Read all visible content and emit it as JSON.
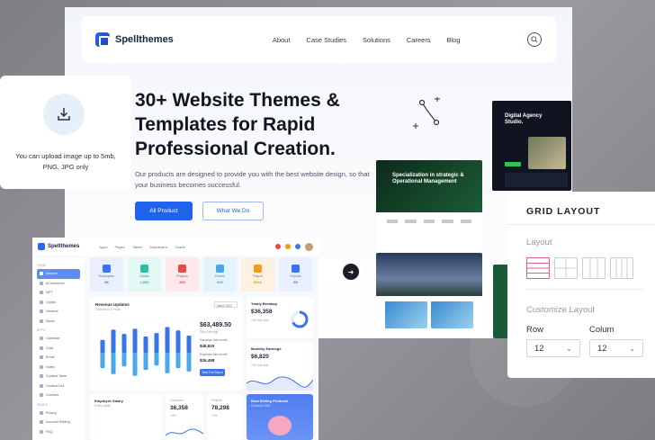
{
  "landing": {
    "brand": "Spellthemes",
    "nav": [
      "About",
      "Case Studies",
      "Solutions",
      "Careers",
      "Blog"
    ],
    "hero_title": "30+ Website Themes & Templates for Rapid Professional Creation.",
    "hero_subtitle": "Our products are designed to provide you with the best website design, so that your business becomes successful.",
    "primary_button": "All Product",
    "secondary_button": "What We Do",
    "previews": {
      "agency_title": "Digital Agency Studio.",
      "strategy_title": "Specialization in strategic & Operational Management"
    }
  },
  "upload": {
    "icon": "upload-icon",
    "text": "You can upload image up to 5mb, PNG, JPG only"
  },
  "dashboard": {
    "brand": "Spellthemes",
    "menu": [
      "Apps",
      "Pages",
      "Tables",
      "Dashboard",
      "Charts"
    ],
    "sidebar": {
      "section_home": "HOME",
      "home_items": [
        "Modern",
        "eCommerce",
        "NFT",
        "Crypto",
        "General",
        "Music"
      ],
      "section_apps": "APPS",
      "app_items": [
        "Calendar",
        "Chat",
        "Email",
        "Notes",
        "Contact Table",
        "Contact List",
        "Courses"
      ],
      "section_pages": "PAGES",
      "page_items": [
        "Pricing",
        "Account Setting",
        "FAQ"
      ]
    },
    "tiles": [
      {
        "label": "Employees",
        "value": "96",
        "color": "#3b73ea",
        "bg": "#e8f0fd"
      },
      {
        "label": "Clients",
        "value": "3,650",
        "color": "#2bbfa3",
        "bg": "#e4f8f4"
      },
      {
        "label": "Projects",
        "value": "356",
        "color": "#e24b4b",
        "bg": "#fde9e9"
      },
      {
        "label": "Events",
        "value": "696",
        "color": "#4aa8e8",
        "bg": "#e4f3fc"
      },
      {
        "label": "Payroll",
        "value": "$96k",
        "color": "#f29b1a",
        "bg": "#fdf2e1"
      },
      {
        "label": "Reports",
        "value": "59",
        "color": "#3b73ea",
        "bg": "#e8f0fd"
      }
    ],
    "revenue": {
      "title": "Revenue Updates",
      "subtitle": "Overview of Profit",
      "period": "March 2023",
      "total": "$63,489.50",
      "total_label": "Total Earnings",
      "earnings_label": "Earnings this month",
      "earnings_value": "$48,820",
      "expense_label": "Expense this month",
      "expense_value": "$26,498",
      "button": "View Full Report"
    },
    "yearly_breakup": {
      "title": "Yearly Breakup",
      "value": "$36,358",
      "note": "+9% last year"
    },
    "monthly_earnings": {
      "title": "Monthly Earnings",
      "value": "$6,820",
      "note": "+9% last year"
    },
    "employee_salary": {
      "title": "Employee Salary",
      "subtitle": "Every month"
    },
    "customers": {
      "title": "Customers",
      "value": "36,358",
      "note": "+9%"
    },
    "projects": {
      "title": "Projects",
      "value": "78,298",
      "note": "+9%"
    },
    "best_selling": {
      "title": "Best Selling Products",
      "subtitle": "Overview 2023"
    }
  },
  "grid_card": {
    "title": "GRID LAYOUT",
    "layout_label": "Layout",
    "customize_label": "Customize Layout",
    "row_label": "Row",
    "row_value": "12",
    "column_label": "Colum",
    "column_value": "12"
  },
  "revenue_chart": {
    "type": "bar",
    "categories": [
      "Jan",
      "Feb",
      "Mar",
      "Apr",
      "May",
      "Jun",
      "Jul",
      "Aug",
      "Sep"
    ],
    "series": [
      {
        "values": [
          1.5,
          2.7,
          2.2,
          2.8,
          1.9,
          2.3,
          3.0,
          2.6,
          2.0
        ]
      },
      {
        "values": [
          -1.8,
          -2.5,
          -1.6,
          -2.7,
          -2.0,
          -1.5,
          -2.4,
          -1.8,
          -2.2
        ]
      }
    ],
    "ylim": [
      -4,
      4
    ],
    "colors": [
      "#3b73ea",
      "#4aa8e8"
    ]
  }
}
